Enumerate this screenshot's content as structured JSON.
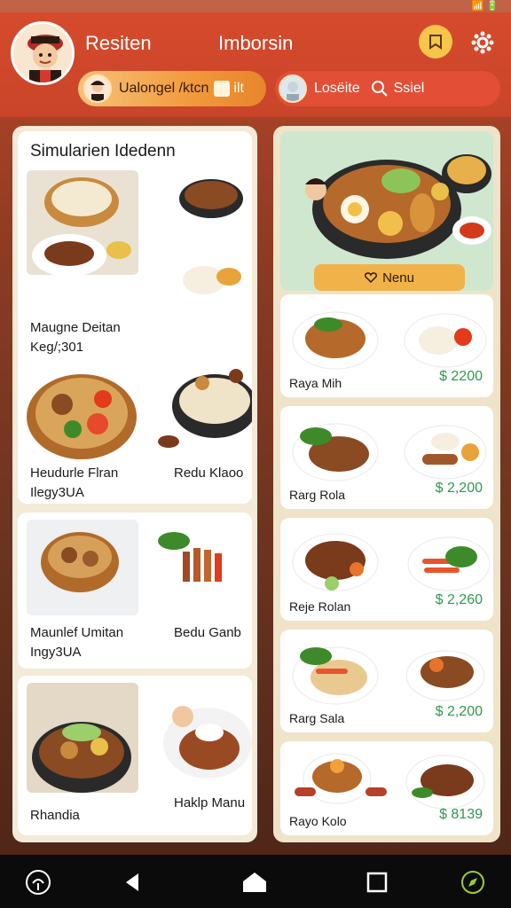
{
  "status_bar": {
    "icons": "📶 🔋"
  },
  "header": {
    "title": "Resiten",
    "subtitle": "Imborsin",
    "pill_left_label": "Ualongel /ktcn",
    "pill_left_tag": "ilt",
    "pill_right_label": "Losëite",
    "search_label": "Ssiel"
  },
  "left_panel": {
    "title": "Simularien Idedenn",
    "cards": [
      {
        "caption_1": "Maugne Deitan",
        "caption_2": "Keg/;301"
      },
      {
        "caption_1": "Heudurle Flran",
        "caption_2": "Ilegy3UA",
        "caption_right": "Redu Klaoo"
      },
      {
        "caption_1": "Maunlef Umitan",
        "caption_2": "Ingy3UA",
        "caption_right": "Bedu Ganb"
      },
      {
        "caption_1": "Rhandia",
        "caption_right": "Haklp Manu"
      }
    ]
  },
  "right_panel": {
    "menu_button": "Nenu",
    "items": [
      {
        "name": "Raya Mih",
        "price": "$ 2200"
      },
      {
        "name": "Rarg Rola",
        "price": "$ 2,200"
      },
      {
        "name": "Reje Rolan",
        "price": "$ 2,260"
      },
      {
        "name": "Rarg Sala",
        "price": "$ 2,200"
      },
      {
        "name": "Rayo Kolo",
        "price": "$ 8139"
      }
    ]
  },
  "colors": {
    "header_red": "#d64a2c",
    "accent_orange": "#f19a3c",
    "price_green": "#2e9a4a",
    "menu_yellow": "#f2b24a"
  },
  "nav": {
    "icons": [
      "assistant-icon",
      "back-icon",
      "home-icon",
      "recents-icon",
      "settings-icon"
    ]
  }
}
